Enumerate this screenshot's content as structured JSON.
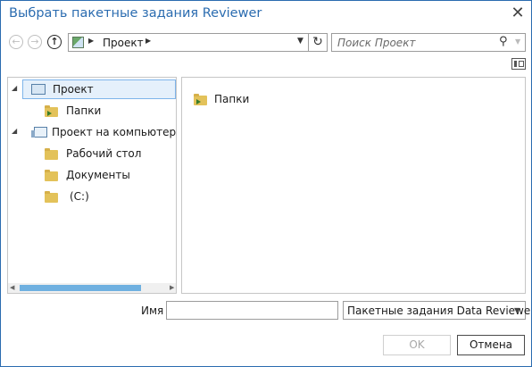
{
  "dialog": {
    "title": "Выбрать пакетные задания Reviewer",
    "close_glyph": "✕"
  },
  "nav": {
    "back_glyph": "←",
    "forward_glyph": "→",
    "up_glyph": "↑",
    "path_sep": "▶",
    "path_label": "Проект",
    "path_drop": "▼",
    "refresh_glyph": "↻"
  },
  "search": {
    "placeholder": "Поиск Проект",
    "icon_glyph": "⚲",
    "drop_glyph": "▼"
  },
  "tree": {
    "items": [
      {
        "label": "Проект",
        "expanded": true,
        "selected": true
      },
      {
        "label": "Папки"
      },
      {
        "label": "Проект на компьютере",
        "expanded": true
      },
      {
        "label": "Рабочий стол"
      },
      {
        "label": "Документы"
      },
      {
        "label": "(C:)"
      }
    ],
    "expand_glyph": "◢",
    "scroll_left": "◀",
    "scroll_right": "▶"
  },
  "content": {
    "items": [
      {
        "label": "Папки"
      }
    ]
  },
  "footer": {
    "name_label": "Имя",
    "name_value": "",
    "filter_value": "Пакетные задания Data Reviewer",
    "filter_drop": "▼",
    "ok_label": "OK",
    "cancel_label": "Отмена"
  },
  "colors": {
    "accent": "#2b6cb0",
    "selection": "#e5f0fb",
    "folder": "#e3c25a"
  }
}
